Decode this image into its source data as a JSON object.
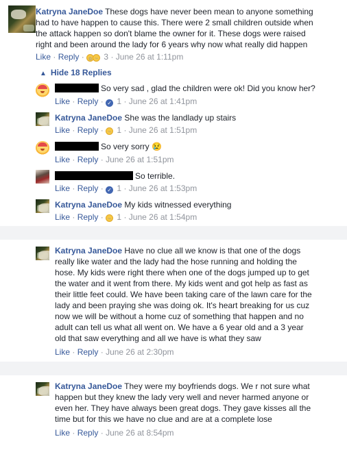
{
  "thread": {
    "hide_replies_label": "Hide 18 Replies"
  },
  "top_comment": {
    "author": "Katryna JaneDoe",
    "text_lines": [
      "These dogs have never been mean to anyone something",
      "had to have happen to cause this. There were 2 small children outside when",
      "the attack happen so don't blame the owner for it. These dogs were raised",
      "right and been around the lady for 6 years why now what really did happen"
    ],
    "like": "Like",
    "reply": "Reply",
    "reaction_count": "3",
    "time": "June 26 at 1:11pm"
  },
  "replies": [
    {
      "author": "",
      "text": "So very sad , glad the children were ok! Did you know her?",
      "like": "Like",
      "reply": "Reply",
      "reaction": "like",
      "reaction_count": "1",
      "time": "June 26 at 1:41pm"
    },
    {
      "author": "Katryna JaneDoe",
      "text": "She was the landlady up stairs",
      "like": "Like",
      "reply": "Reply",
      "reaction": "sad",
      "reaction_count": "1",
      "time": "June 26 at 1:51pm"
    },
    {
      "author": "",
      "text": "So very sorry",
      "emoji": "😢",
      "like": "Like",
      "reply": "Reply",
      "time": "June 26 at 1:51pm"
    },
    {
      "author": "",
      "text": "So terrible.",
      "like": "Like",
      "reply": "Reply",
      "reaction": "like",
      "reaction_count": "1",
      "time": "June 26 at 1:53pm"
    },
    {
      "author": "Katryna JaneDoe",
      "text": "My kids witnessed everything",
      "like": "Like",
      "reply": "Reply",
      "reaction": "sad",
      "reaction_count": "1",
      "time": "June 26 at 1:54pm"
    }
  ],
  "comment2": {
    "author": "Katryna JaneDoe",
    "text_lines": [
      "Have no clue all we know is that one of the dogs",
      "really like water and the lady had the hose running and holding the",
      "hose. My kids were right there when one of the dogs jumped up to get",
      "the water and it went from there. My kids went and got help as fast as",
      "their little feet could. We have been taking care of the lawn care for the",
      "lady and been praying she was doing ok. It's heart breaking for us cuz",
      "now we will be without a home cuz of something that happen and no",
      "adult can tell us what all went on. We have a 6 year old and a 3 year",
      "old that saw everything and all we have is what they saw"
    ],
    "like": "Like",
    "reply": "Reply",
    "time": "June 26 at 2:30pm"
  },
  "comment3": {
    "author": "Katryna JaneDoe",
    "text_lines": [
      "They were my boyfriends dogs. We r not sure what",
      "happen but they knew the lady very well and never harmed anyone or",
      "even her. They have always been great dogs. They gave kisses all the",
      "time but for this we have no clue and are at a complete lose"
    ],
    "like": "Like",
    "reply": "Reply",
    "time": "June 26 at 8:54pm"
  },
  "separator": "·",
  "colors": {
    "author_link": "#365899",
    "meta_text": "#90949c",
    "background": "#f2f3f5",
    "like_reaction": "#4267b2"
  }
}
